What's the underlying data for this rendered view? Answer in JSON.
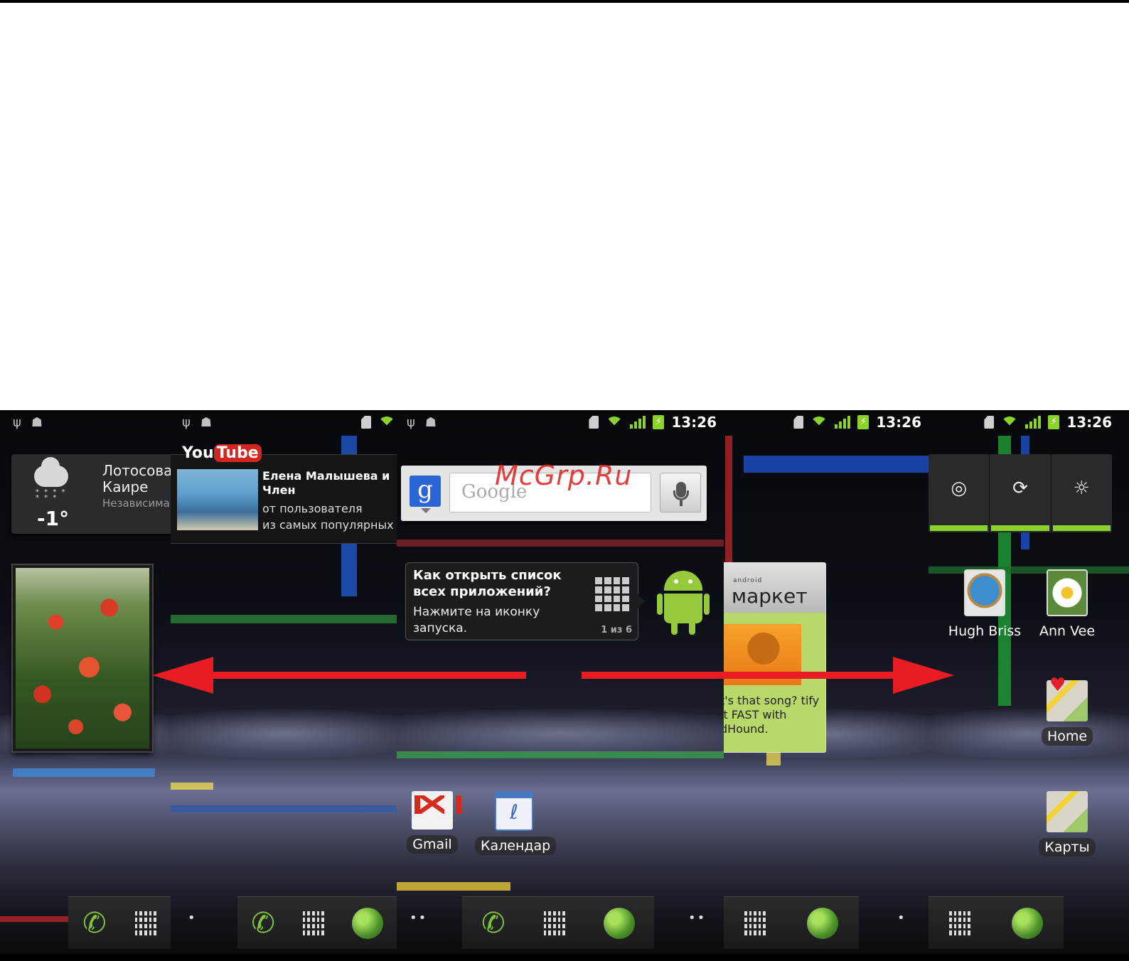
{
  "status_bar": {
    "time": "13:26"
  },
  "weather": {
    "city": "Лотосовая\nКаире",
    "temperature": "-1°",
    "region": "Независима"
  },
  "youtube": {
    "logo_you": "You",
    "logo_tube": "Tube",
    "video_title": "Елена Малышева и Член",
    "line1": "от пользователя",
    "line2": "из самых популярных"
  },
  "search": {
    "placeholder": "Google",
    "g_letter": "g"
  },
  "watermark": "McGrp.Ru",
  "tip": {
    "title": "Как открыть список всех приложений?",
    "body": "Нажмите на иконку запуска.",
    "counter": "1 из 6"
  },
  "apps": {
    "gmail": "Gmail",
    "calendar": "Календар"
  },
  "market": {
    "small_label": "android",
    "name": "маркет",
    "promo_text": "t's that song? tify it FAST with dHound."
  },
  "contacts": [
    {
      "name": "Hugh Briss"
    },
    {
      "name": "Ann Vee"
    }
  ],
  "shortcuts": {
    "home": "Home",
    "maps": "Карты"
  },
  "quick_settings": [
    "gps-icon",
    "sync-icon",
    "brightness-icon"
  ]
}
